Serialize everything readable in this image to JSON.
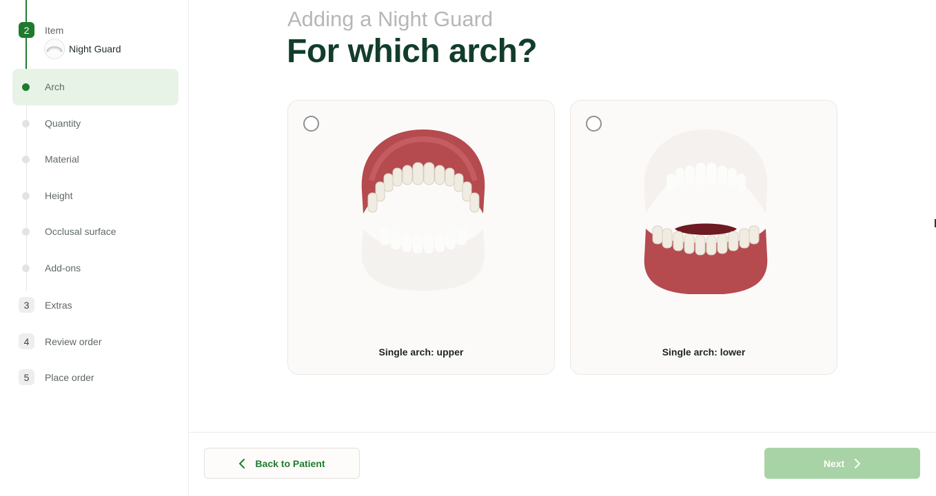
{
  "sidebar": {
    "current_step": {
      "number": "2",
      "label": "Item",
      "item_name": "Night Guard"
    },
    "substeps": [
      {
        "label": "Arch",
        "active": true
      },
      {
        "label": "Quantity",
        "active": false
      },
      {
        "label": "Material",
        "active": false
      },
      {
        "label": "Height",
        "active": false
      },
      {
        "label": "Occlusal surface",
        "active": false
      },
      {
        "label": "Add-ons",
        "active": false
      }
    ],
    "steps": [
      {
        "number": "3",
        "label": "Extras"
      },
      {
        "number": "4",
        "label": "Review order"
      },
      {
        "number": "5",
        "label": "Place order"
      }
    ]
  },
  "main": {
    "kicker": "Adding a Night Guard",
    "title": "For which arch?",
    "options": [
      {
        "label": "Single arch: upper",
        "selected": false,
        "icon": "upper-arch-teeth"
      },
      {
        "label": "Single arch: lower",
        "selected": false,
        "icon": "lower-arch-teeth"
      }
    ]
  },
  "footer": {
    "back_label": "Back to Patient",
    "next_label": "Next"
  },
  "colors": {
    "brand_green": "#1f7a2e",
    "active_row_bg": "#e8f3e7",
    "next_disabled": "#a8d3a6",
    "title": "#123d2a"
  }
}
